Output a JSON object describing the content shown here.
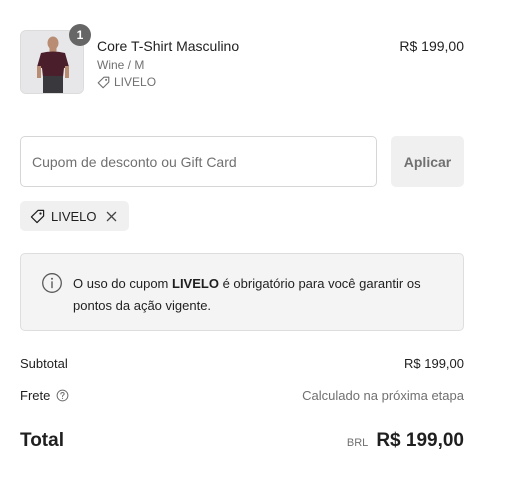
{
  "product": {
    "quantity": "1",
    "name": "Core T-Shirt Masculino",
    "variant": "Wine / M",
    "discount_tag": "LIVELO",
    "price": "R$ 199,00",
    "image_icon": "product-photo"
  },
  "coupon": {
    "placeholder": "Cupom de desconto ou Gift Card",
    "value": "",
    "apply_label": "Aplicar"
  },
  "applied_code": {
    "label": "LIVELO",
    "remove_icon": "close-icon"
  },
  "notice": {
    "icon": "info-icon",
    "text_before": "O uso do cupom ",
    "code": "LIVELO",
    "text_after": " é obrigatório para você garantir os pontos da ação vigente."
  },
  "summary": {
    "subtotal_label": "Subtotal",
    "subtotal_value": "R$ 199,00",
    "shipping_label": "Frete",
    "shipping_value": "Calculado na próxima etapa",
    "total_label": "Total",
    "currency": "BRL",
    "total_value": "R$ 199,00"
  },
  "colors": {
    "shirt": "#4a1f2b",
    "badge": "#666666",
    "notice_bg": "#f4f4f4"
  }
}
